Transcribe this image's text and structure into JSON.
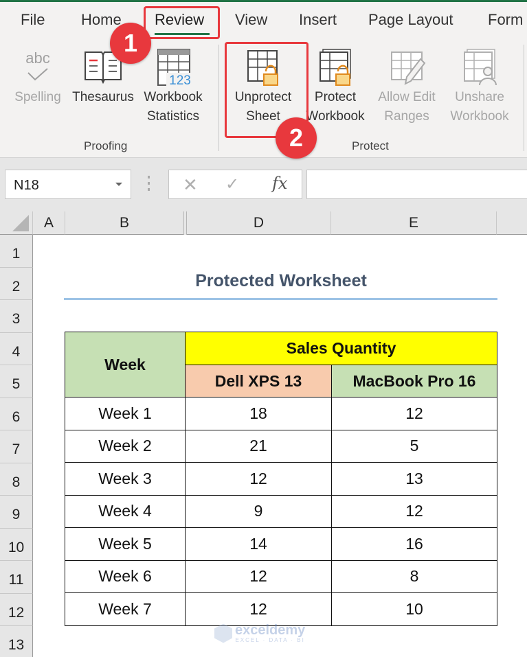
{
  "ribbon": {
    "tabs": [
      {
        "label": "File"
      },
      {
        "label": "Home"
      },
      {
        "label": "Review",
        "active": true
      },
      {
        "label": "View"
      },
      {
        "label": "Insert"
      },
      {
        "label": "Page Layout"
      },
      {
        "label": "Form"
      }
    ],
    "groups": {
      "proofing": {
        "label": "Proofing",
        "buttons": [
          {
            "line1": "Spelling",
            "line2": "",
            "icon": "spelling-icon",
            "enabled": false
          },
          {
            "line1": "Thesaurus",
            "line2": "",
            "icon": "thesaurus-icon",
            "enabled": true
          },
          {
            "line1": "Workbook",
            "line2": "Statistics",
            "icon": "workbook-statistics-icon",
            "enabled": true
          }
        ]
      },
      "protect": {
        "label": "Protect",
        "buttons": [
          {
            "line1": "Unprotect",
            "line2": "Sheet",
            "icon": "unprotect-sheet-icon",
            "enabled": true
          },
          {
            "line1": "Protect",
            "line2": "Workbook",
            "icon": "protect-workbook-icon",
            "enabled": true
          },
          {
            "line1": "Allow Edit",
            "line2": "Ranges",
            "icon": "allow-edit-ranges-icon",
            "enabled": false
          },
          {
            "line1": "Unshare",
            "line2": "Workbook",
            "icon": "unshare-workbook-icon",
            "enabled": false
          }
        ]
      }
    },
    "icon_text": {
      "abc": "abc",
      "num123": "123"
    }
  },
  "callouts": [
    {
      "number": "1",
      "target": "Review tab"
    },
    {
      "number": "2",
      "target": "Unprotect Sheet"
    }
  ],
  "formula_bar": {
    "name_box": "N18",
    "cancel_glyph": "✕",
    "enter_glyph": "✓",
    "fx_label": "fx",
    "formula": ""
  },
  "columns": [
    "A",
    "B",
    "D",
    "E"
  ],
  "rows": [
    "1",
    "2",
    "3",
    "4",
    "5",
    "6",
    "7",
    "8",
    "9",
    "10",
    "11",
    "12",
    "13"
  ],
  "sheet": {
    "title": "Protected Worksheet",
    "table": {
      "header_week": "Week",
      "header_group": "Sales Quantity",
      "header_cols": [
        "Dell XPS 13",
        "MacBook Pro 16"
      ],
      "rows": [
        {
          "week": "Week 1",
          "dell": "18",
          "mac": "12"
        },
        {
          "week": "Week 2",
          "dell": "21",
          "mac": "5"
        },
        {
          "week": "Week 3",
          "dell": "12",
          "mac": "13"
        },
        {
          "week": "Week 4",
          "dell": "9",
          "mac": "12"
        },
        {
          "week": "Week 5",
          "dell": "14",
          "mac": "16"
        },
        {
          "week": "Week 6",
          "dell": "12",
          "mac": "8"
        },
        {
          "week": "Week 7",
          "dell": "12",
          "mac": "10"
        }
      ]
    },
    "colors": {
      "week_header": "#c6e0b4",
      "sales_header": "#ffff00",
      "dell_header": "#f8cbad",
      "mac_header": "#c6e0b4",
      "title_text": "#44546a",
      "title_rule": "#9dc3e6"
    }
  },
  "watermark": {
    "name": "exceldemy",
    "tagline": "EXCEL · DATA · BI"
  },
  "theme": {
    "accent_green": "#217346",
    "callout_red": "#e8383d",
    "lock_orange": "#f4b942"
  }
}
